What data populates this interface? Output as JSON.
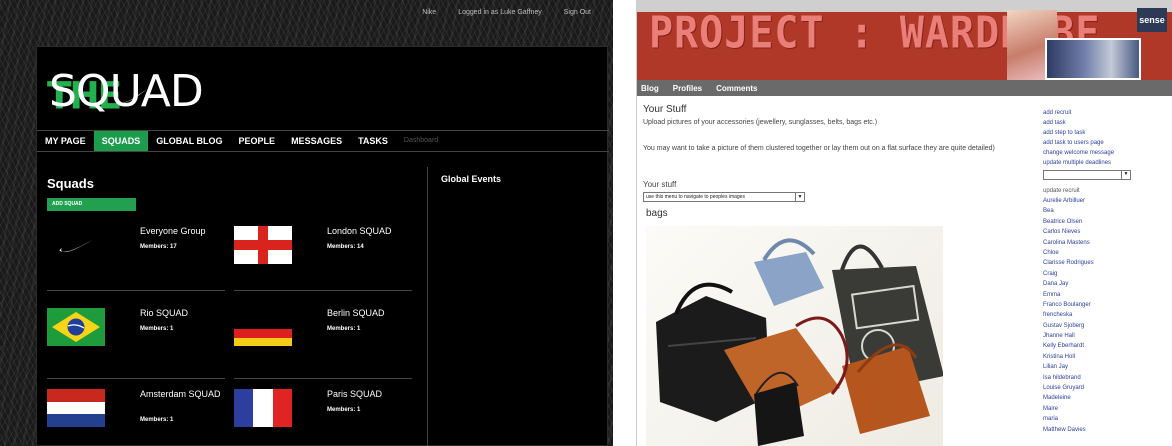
{
  "squad_app": {
    "top_links": [
      "Nike",
      "Logged in as Luke Gaffney",
      "Sign Out"
    ],
    "logo": {
      "left": "THE",
      "right": "SQUAD"
    },
    "nav": [
      {
        "label": "MY PAGE"
      },
      {
        "label": "SQUADS",
        "active": true
      },
      {
        "label": "GLOBAL BLOG"
      },
      {
        "label": "PEOPLE"
      },
      {
        "label": "MESSAGES"
      },
      {
        "label": "TASKS"
      },
      {
        "label": "Dashboard",
        "muted": true
      }
    ],
    "section_title": "Squads",
    "add_button": "ADD SQUAD",
    "side_title": "Global Events",
    "squads": [
      {
        "name": "Everyone Group",
        "members": "Members: 17",
        "flag": "nike-swoosh"
      },
      {
        "name": "London SQUAD",
        "members": "Members: 14",
        "flag": "england"
      },
      {
        "name": "Rio SQUAD",
        "members": "Members: 1",
        "flag": "brazil"
      },
      {
        "name": "Berlin SQUAD",
        "members": "Members: 1",
        "flag": "germany"
      },
      {
        "name": "Amsterdam SQUAD",
        "members": "Members: 1",
        "flag": "netherlands"
      },
      {
        "name": "Paris SQUAD",
        "members": "Members: 1",
        "flag": "france"
      }
    ],
    "colors": {
      "accent": "#1e9c4e",
      "background": "#000000"
    }
  },
  "wardrobe_app": {
    "banner_title": "PROJECT : WARDROBE",
    "brand_badge": "sense",
    "nav": [
      "Blog",
      "Profiles",
      "Comments"
    ],
    "page_title": "Your Stuff",
    "paragraph1": "Upload pictures of your accessories (jewellery, sunglasses, belts, bags etc.)",
    "paragraph2": "You may want to take a picture of them clustered together or lay them out on a flat surface they are quite detailed)",
    "select_label": "Your stuff",
    "select_value": "use this menu to navigate to peoples images",
    "section": "bags",
    "admin_links": [
      "add recruit",
      "add task",
      "add step to task",
      "add task to users page",
      "change welcome message",
      "update multiple deadlines"
    ],
    "recruit_heading": "update recruit",
    "recruits": [
      "Aurelie Arbilluer",
      "Bea",
      "Beatrice Olsen",
      "Carlos Nieves",
      "Carolina Mastens",
      "Chloe",
      "Clarisse Rodrigues",
      "Craig",
      "Dana Jay",
      "Emma",
      "Franco Boulanger",
      "frencheska",
      "Gustav Sjoberg",
      "Jhanne Hall",
      "Kelly Eberhardt",
      "Kristina Holl",
      "Lilian Jay",
      "Isa hildebrand",
      "Louise Gruyard",
      "Madeleine",
      "Maire",
      "maria",
      "Matthew Davies"
    ],
    "colors": {
      "banner": "#b03828",
      "link": "#2a3f9b",
      "nav": "#6a6a6a"
    }
  }
}
